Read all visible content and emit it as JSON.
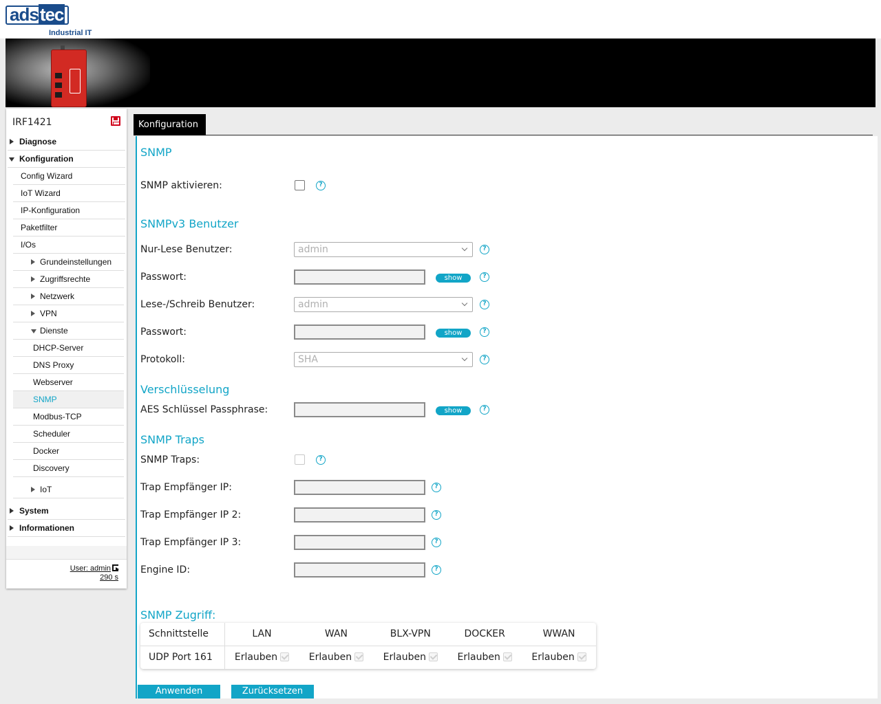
{
  "logo": {
    "brand_left": "ads",
    "brand_right": "tec",
    "subtitle": "Industrial IT"
  },
  "sidebar": {
    "device_name": "IRF1421",
    "nav": [
      {
        "label": "Diagnose",
        "level": "l0",
        "arrow": "right"
      },
      {
        "label": "Konfiguration",
        "level": "l0",
        "arrow": "down"
      },
      {
        "label": "Config Wizard",
        "level": "l1"
      },
      {
        "label": "IoT Wizard",
        "level": "l1"
      },
      {
        "label": "IP-Konfiguration",
        "level": "l1"
      },
      {
        "label": "Paketfilter",
        "level": "l1"
      },
      {
        "label": "I/Os",
        "level": "l1"
      },
      {
        "label": "Grundeinstellungen",
        "level": "l2",
        "arrow": "right"
      },
      {
        "label": "Zugriffsrechte",
        "level": "l2",
        "arrow": "right"
      },
      {
        "label": "Netzwerk",
        "level": "l2",
        "arrow": "right"
      },
      {
        "label": "VPN",
        "level": "l2",
        "arrow": "right"
      },
      {
        "label": "Dienste",
        "level": "l2",
        "arrow": "down"
      },
      {
        "label": "DHCP-Server",
        "level": "l3"
      },
      {
        "label": "DNS Proxy",
        "level": "l3"
      },
      {
        "label": "Webserver",
        "level": "l3"
      },
      {
        "label": "SNMP",
        "level": "l3",
        "active": true
      },
      {
        "label": "Modbus-TCP",
        "level": "l3"
      },
      {
        "label": "Scheduler",
        "level": "l3"
      },
      {
        "label": "Docker",
        "level": "l3"
      },
      {
        "label": "Discovery",
        "level": "l3"
      },
      {
        "spacer": true
      },
      {
        "label": "IoT",
        "level": "l2",
        "arrow": "right"
      },
      {
        "spacer": true
      },
      {
        "label": "System",
        "level": "l0",
        "arrow": "right"
      },
      {
        "label": "Informationen",
        "level": "l0",
        "arrow": "right"
      }
    ],
    "user": "User: admin",
    "timer": "290 s"
  },
  "tabs": {
    "active": "Konfiguration"
  },
  "snmp": {
    "title": "SNMP",
    "enable_label": "SNMP aktivieren:",
    "v3_title": "SNMPv3 Benutzer",
    "ro_user_label": "Nur-Lese Benutzer:",
    "ro_user_value": "admin",
    "password_label": "Passwort:",
    "rw_user_label": "Lese-/Schreib Benutzer:",
    "rw_user_value": "admin",
    "protocol_label": "Protokoll:",
    "protocol_value": "SHA",
    "show_label": "show",
    "enc_title": "Verschlüsselung",
    "aes_label": "AES Schlüssel Passphrase:",
    "traps_title": "SNMP Traps",
    "traps_label": "SNMP Traps:",
    "trap_ip1_label": "Trap Empfänger IP:",
    "trap_ip2_label": "Trap Empfänger IP 2:",
    "trap_ip3_label": "Trap Empfänger IP 3:",
    "engine_label": "Engine ID:",
    "access_title": "SNMP Zugriff:",
    "access_headers": [
      "Schnittstelle",
      "LAN",
      "WAN",
      "BLX-VPN",
      "DOCKER",
      "WWAN"
    ],
    "access_row_label": "UDP Port 161",
    "access_cell_label": "Erlauben"
  },
  "buttons": {
    "apply": "Anwenden",
    "reset": "Zurücksetzen"
  },
  "colors": {
    "accent": "#12a5c7",
    "brand": "#1a4c8b",
    "save": "#d0021b"
  }
}
